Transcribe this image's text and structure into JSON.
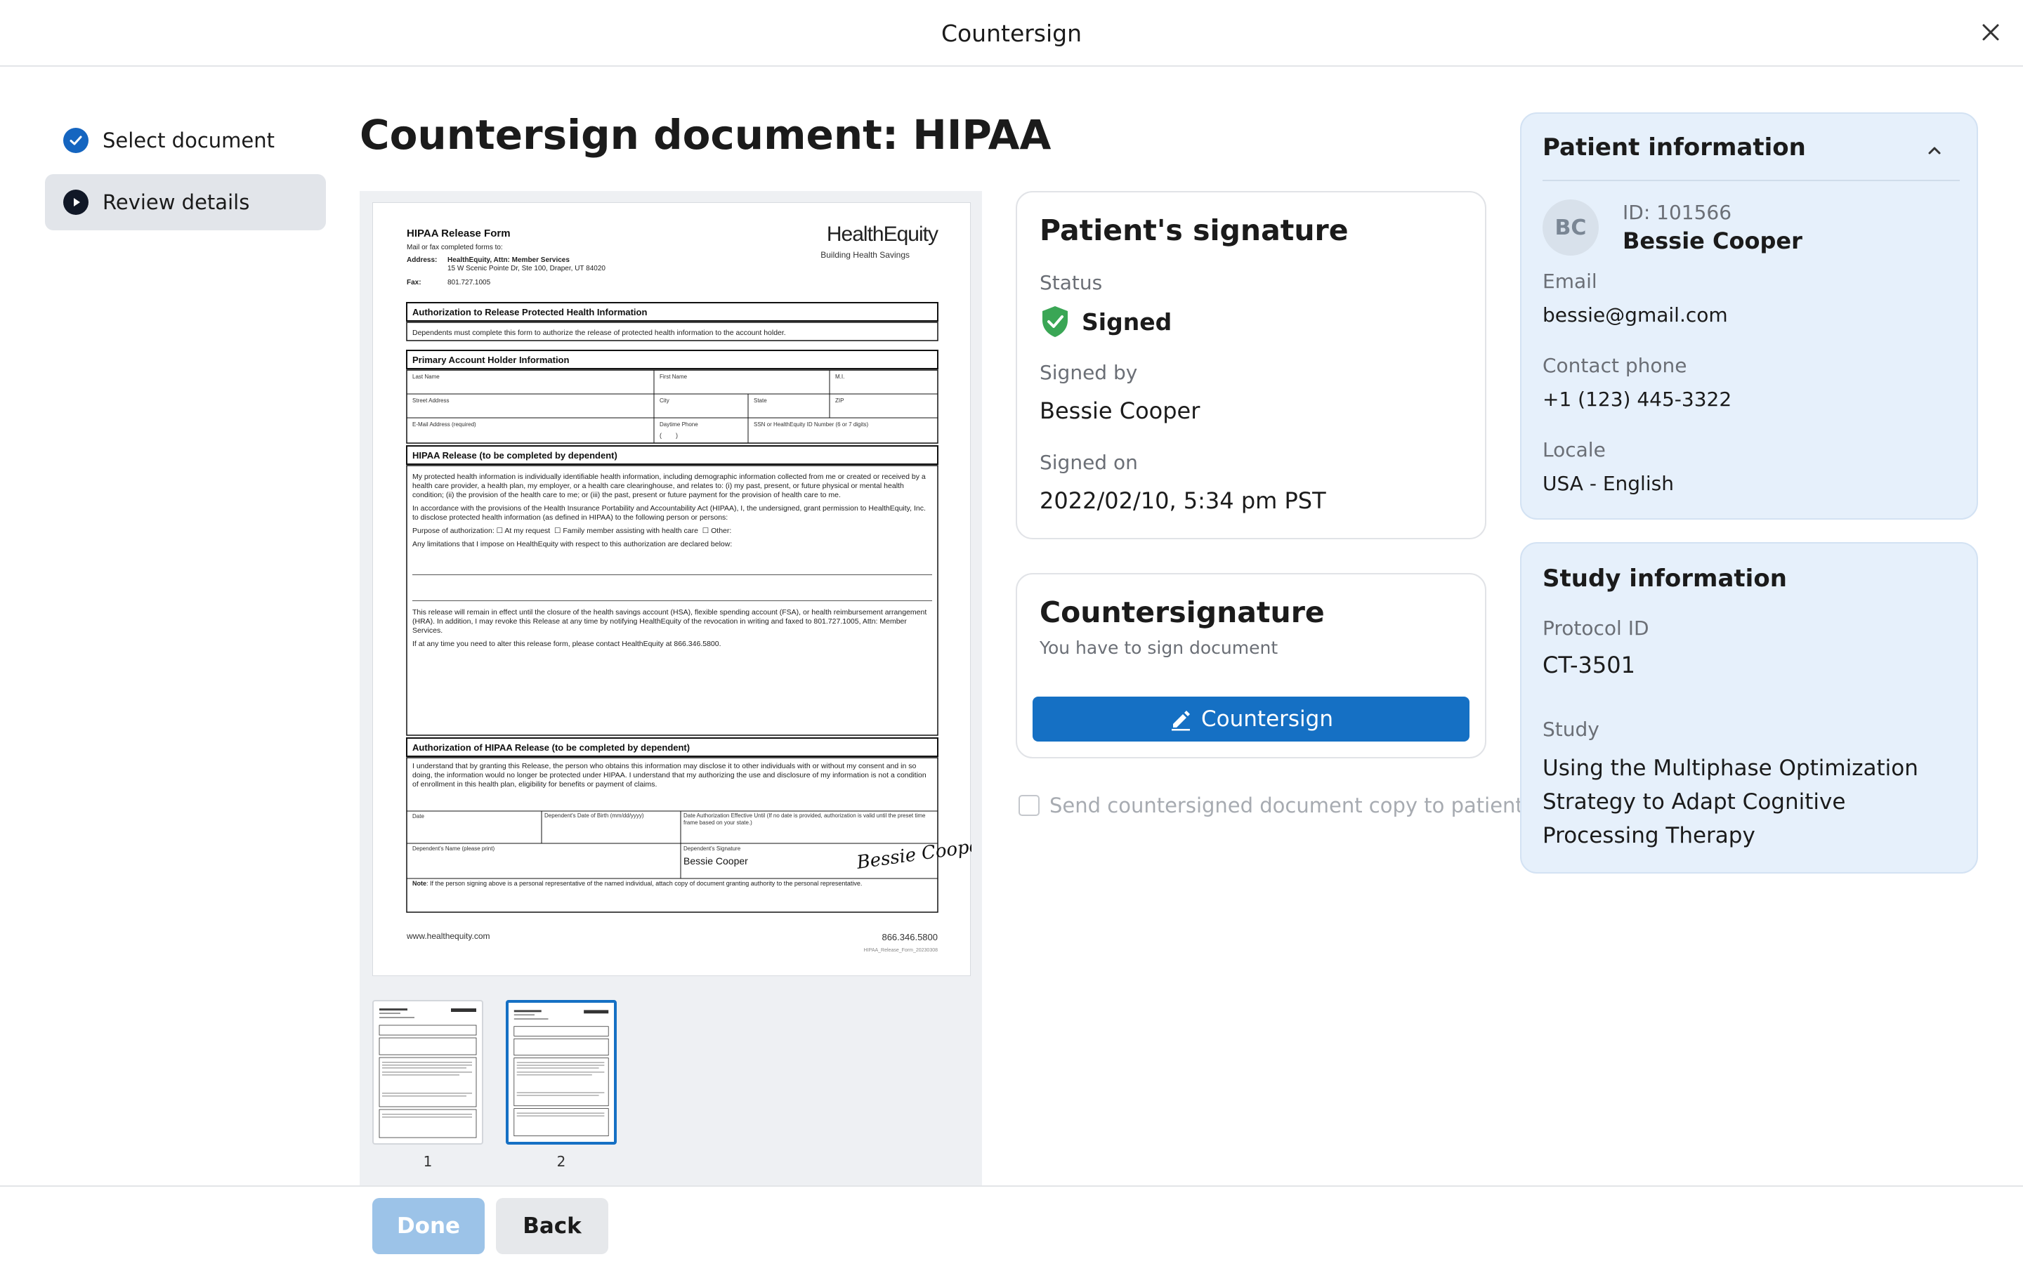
{
  "modal": {
    "title": "Countersign"
  },
  "steps": [
    {
      "label": "Select document",
      "state": "completed"
    },
    {
      "label": "Review details",
      "state": "current"
    }
  ],
  "page_title": "Countersign document: HIPAA",
  "document": {
    "brand": "HealthEquity",
    "brand_tagline": "Building Health Savings",
    "form_title": "HIPAA Release Form",
    "mail_line": "Mail or fax completed forms to:",
    "address_label": "Address:",
    "address_1": "HealthEquity, Attn: Member Services",
    "address_2": "15 W Scenic Pointe Dr, Ste 100, Draper, UT 84020",
    "fax_label": "Fax:",
    "fax": "801.727.1005",
    "sec1_title": "Authorization to Release Protected Health Information",
    "sec1_text": "Dependents must complete this form to authorize the release of protected health information to the account holder.",
    "sec2_title": "Primary Account Holder Information",
    "sec2_fields": [
      "Last Name",
      "First Name",
      "M.I.",
      "Street Address",
      "City",
      "State",
      "ZIP",
      "E-Mail Address (required)",
      "Daytime Phone",
      "SSN or HealthEquity ID Number (6 or 7 digits)"
    ],
    "phone_parens": "(        )",
    "sec3_title": "HIPAA Release (to be completed by dependent)",
    "sec3_p1": "My protected health information is individually identifiable health information, including demographic information collected from me or created or received by a health care provider, a health plan, my employer, or a health care clearinghouse, and relates to: (i) my past, present, or future physical or mental health condition; (ii) the provision of the health care to me; or (iii) the past, present or future payment for the provision of health care to me.",
    "sec3_p2": "In accordance with the provisions of the Health Insurance Portability and Accountability Act (HIPAA), I, the undersigned, grant permission to HealthEquity, Inc. to disclose protected health information (as defined in HIPAA) to the following person or persons:",
    "purpose_label": "Purpose of authorization:",
    "purpose_opt1": "At my request",
    "purpose_opt2": "Family member assisting with health care",
    "purpose_opt3": "Other:",
    "limits": "Any limitations that I impose on HealthEquity with respect to this authorization are declared below:",
    "sec3_p3": "This release will remain in effect until the closure of the health savings account (HSA), flexible spending account (FSA), or health reimbursement arrangement (HRA). In addition, I may revoke this Release at any time by notifying HealthEquity of the revocation in writing and faxed to 801.727.1005, Attn: Member Services.",
    "sec3_p4": "If at any time you need to alter this release form, please contact HealthEquity at 866.346.5800.",
    "sec4_title": "Authorization of HIPAA Release (to be completed by dependent)",
    "sec4_p1": "I understand that by granting this Release, the person who obtains this information may disclose it to other individuals with or without my consent and in so doing, the information would no longer be protected under HIPAA. I understand that my authorizing the use and disclosure of my information is not a condition of enrollment in this health plan, eligibility for benefits or payment of claims.",
    "f_date": "Date",
    "f_dob": "Dependent's Date of Birth (mm/dd/yyyy)",
    "f_effective": "Date Authorization Effective Until (If no date is provided, authorization is valid until the preset time frame based on your state.)",
    "f_name": "Dependent's Name (please print)",
    "f_sig": "Dependent's Signature",
    "signer_name": "Bessie Cooper",
    "signature_script": "Bessie Cooper",
    "note_label": "Note",
    "note_text": ": If the person signing above is a personal representative of the named individual, attach copy of document granting authority to the personal representative.",
    "website": "www.healthequity.com",
    "phone": "866.346.5800",
    "form_code": "HIPAA_Release_Form_20230308"
  },
  "thumbnails": [
    {
      "number": "1"
    },
    {
      "number": "2",
      "selected": true
    }
  ],
  "patient_signature": {
    "title": "Patient's signature",
    "status_label": "Status",
    "status_value": "Signed",
    "signed_by_label": "Signed by",
    "signed_by_value": "Bessie Cooper",
    "signed_on_label": "Signed on",
    "signed_on_value": "2022/02/10, 5:34 pm PST"
  },
  "countersignature": {
    "title": "Countersignature",
    "subtitle": "You have to sign document",
    "button_label": "Countersign"
  },
  "send_copy_label": "Send countersigned document copy to patient",
  "patient_info": {
    "title": "Patient information",
    "initials": "BC",
    "id_text": "ID: 101566",
    "name": "Bessie Cooper",
    "email_label": "Email",
    "email": "bessie@gmail.com",
    "phone_label": "Contact phone",
    "phone": "+1 (123) 445-3322",
    "locale_label": "Locale",
    "locale": "USA - English"
  },
  "study_info": {
    "title": "Study information",
    "protocol_label": "Protocol ID",
    "protocol": "CT-3501",
    "study_label": "Study",
    "study": "Using the Multiphase Optimization Strategy to Adapt Cognitive Processing Therapy"
  },
  "footer": {
    "done_label": "Done",
    "back_label": "Back"
  },
  "colors": {
    "primary": "#1570c4",
    "success": "#3aa655",
    "panel_bg": "#e6f0fb",
    "disabled_primary": "#9cc3e8"
  },
  "icons": {
    "close": "close-icon",
    "step_done": "check-circle-icon",
    "step_current": "play-circle-icon",
    "signed": "shield-check-icon",
    "countersign": "pen-icon",
    "collapse": "chevron-up-icon"
  }
}
